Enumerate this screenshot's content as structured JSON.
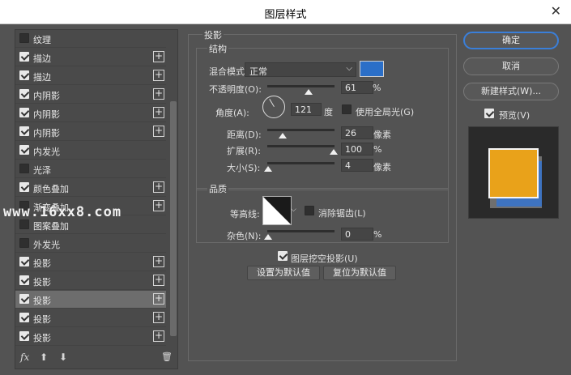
{
  "window": {
    "title": "图层样式",
    "close": "✕"
  },
  "effects": [
    {
      "label": "纹理",
      "checked": false,
      "plus": false,
      "active": false
    },
    {
      "label": "描边",
      "checked": true,
      "plus": true,
      "active": false
    },
    {
      "label": "描边",
      "checked": true,
      "plus": true,
      "active": false
    },
    {
      "label": "内阴影",
      "checked": true,
      "plus": true,
      "active": false
    },
    {
      "label": "内阴影",
      "checked": true,
      "plus": true,
      "active": false
    },
    {
      "label": "内阴影",
      "checked": true,
      "plus": true,
      "active": false
    },
    {
      "label": "内发光",
      "checked": true,
      "plus": false,
      "active": false
    },
    {
      "label": "光泽",
      "checked": false,
      "plus": false,
      "active": false
    },
    {
      "label": "颜色叠加",
      "checked": true,
      "plus": true,
      "active": false
    },
    {
      "label": "渐变叠加",
      "checked": false,
      "plus": true,
      "active": false
    },
    {
      "label": "图案叠加",
      "checked": false,
      "plus": false,
      "active": false
    },
    {
      "label": "外发光",
      "checked": false,
      "plus": false,
      "active": false
    },
    {
      "label": "投影",
      "checked": true,
      "plus": true,
      "active": false
    },
    {
      "label": "投影",
      "checked": true,
      "plus": true,
      "active": false
    },
    {
      "label": "投影",
      "checked": true,
      "plus": true,
      "active": true
    },
    {
      "label": "投影",
      "checked": true,
      "plus": true,
      "active": false
    },
    {
      "label": "投影",
      "checked": true,
      "plus": true,
      "active": false
    }
  ],
  "fx_toolbar": {
    "fx": "fx",
    "up": "⬆",
    "down": "⬇",
    "trash": "🗑"
  },
  "drop_shadow": {
    "section_title": "投影",
    "structure_title": "结构",
    "blend_mode_label": "混合模式:",
    "blend_mode_value": "正常",
    "color": "#2b6fc8",
    "opacity_label": "不透明度(O):",
    "opacity_value": "61",
    "opacity_unit": "%",
    "opacity_level": 61,
    "angle_label": "角度(A):",
    "angle_value": "121",
    "angle_unit": "度",
    "global_light_label": "使用全局光(G)",
    "global_light_checked": false,
    "distance_label": "距离(D):",
    "distance_value": "26",
    "distance_unit": "像素",
    "spread_label": "扩展(R):",
    "spread_value": "100",
    "spread_unit": "%",
    "size_label": "大小(S):",
    "size_value": "4",
    "size_unit": "像素",
    "quality_title": "品质",
    "contour_label": "等高线:",
    "anti_alias_label": "消除锯齿(L)",
    "anti_alias_checked": false,
    "noise_label": "杂色(N):",
    "noise_value": "0",
    "noise_unit": "%",
    "knockout_label": "图层挖空投影(U)",
    "knockout_checked": true,
    "make_default": "设置为默认值",
    "reset_default": "复位为默认值"
  },
  "buttons": {
    "ok": "确定",
    "cancel": "取消",
    "new_style": "新建样式(W)...",
    "preview_label": "预览(V)",
    "preview_checked": true
  },
  "watermark": "www.16xx8.com"
}
